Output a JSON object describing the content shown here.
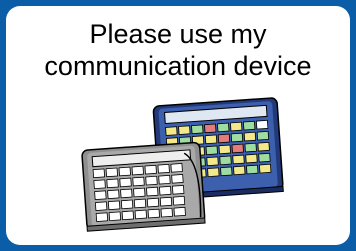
{
  "card": {
    "line1": "Please use my",
    "line2": "communication device"
  },
  "devices_icon": "communication-devices-icon",
  "colors": {
    "frame": "#0a5da6",
    "card": "#ffffff",
    "device_back": "#233a7a",
    "device_front": "#8f8f8f"
  }
}
